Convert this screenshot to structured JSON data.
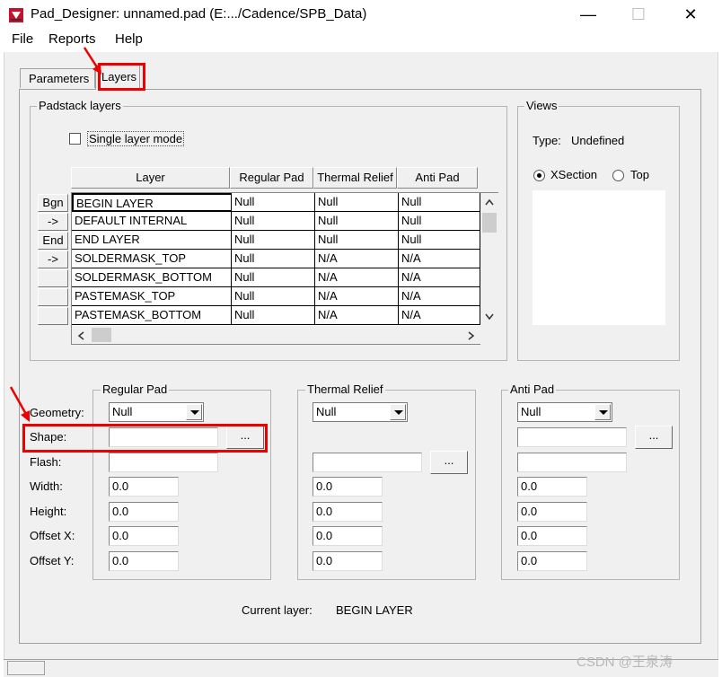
{
  "window": {
    "title": "Pad_Designer: unnamed.pad (E:.../Cadence/SPB_Data)",
    "min_glyph": "—",
    "max_glyph": "☐",
    "close_glyph": "✕"
  },
  "menu": [
    "File",
    "Reports",
    "Help"
  ],
  "tabs": [
    "Parameters",
    "Layers"
  ],
  "padstack": {
    "group_label": "Padstack layers",
    "single_layer_mode": "Single layer mode",
    "columns": [
      "Layer",
      "Regular Pad",
      "Thermal Relief",
      "Anti Pad"
    ],
    "row_buttons": [
      "Bgn",
      "->",
      "End",
      "->",
      "",
      "",
      ""
    ],
    "rows": [
      [
        "BEGIN LAYER",
        "Null",
        "Null",
        "Null"
      ],
      [
        "DEFAULT INTERNAL",
        "Null",
        "Null",
        "Null"
      ],
      [
        "END LAYER",
        "Null",
        "Null",
        "Null"
      ],
      [
        "SOLDERMASK_TOP",
        "Null",
        "N/A",
        "N/A"
      ],
      [
        "SOLDERMASK_BOTTOM",
        "Null",
        "N/A",
        "N/A"
      ],
      [
        "PASTEMASK_TOP",
        "Null",
        "N/A",
        "N/A"
      ],
      [
        "PASTEMASK_BOTTOM",
        "Null",
        "N/A",
        "N/A"
      ]
    ]
  },
  "views": {
    "group_label": "Views",
    "type_label": "Type:",
    "type_value": "Undefined",
    "xsection_label": "XSection",
    "top_label": "Top"
  },
  "params": {
    "labels": [
      "Geometry:",
      "Shape:",
      "Flash:",
      "Width:",
      "Height:",
      "Offset X:",
      "Offset Y:"
    ],
    "regular_pad": {
      "label": "Regular Pad",
      "geometry": "Null",
      "width": "0.0",
      "height": "0.0",
      "offset_x": "0.0",
      "offset_y": "0.0"
    },
    "thermal_relief": {
      "label": "Thermal Relief",
      "geometry": "Null",
      "width": "0.0",
      "height": "0.0",
      "offset_x": "0.0",
      "offset_y": "0.0"
    },
    "anti_pad": {
      "label": "Anti Pad",
      "geometry": "Null",
      "width": "0.0",
      "height": "0.0",
      "offset_x": "0.0",
      "offset_y": "0.0"
    },
    "browse_label": "..."
  },
  "current_layer": {
    "label": "Current layer:",
    "value": "BEGIN LAYER"
  },
  "watermark": "CSDN @王泉涛",
  "colors": {
    "annotation_red": "#e00000"
  }
}
